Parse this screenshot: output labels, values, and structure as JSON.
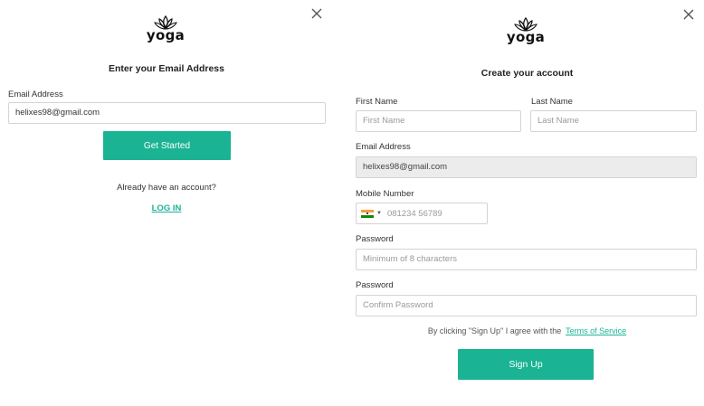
{
  "email_step": {
    "logo_text": "yoga",
    "heading": "Enter your Email Address",
    "email_label": "Email Address",
    "email_value": "helixes98@gmail.com",
    "submit_label": "Get Started",
    "have_account_text": "Already have an account?",
    "login_link": "LOG IN",
    "close_icon": "close-icon"
  },
  "signup": {
    "logo_text": "yoga",
    "heading": "Create your account",
    "first_name_label": "First Name",
    "first_name_placeholder": "First Name",
    "last_name_label": "Last Name",
    "last_name_placeholder": "Last Name",
    "email_label": "Email Address",
    "email_value": "helixes98@gmail.com",
    "mobile_label": "Mobile Number",
    "mobile_placeholder": "081234 56789",
    "country_flag_icon": "india-flag-icon",
    "password_label": "Password",
    "password_placeholder": "Minimum of 8 characters",
    "confirm_label": "Password",
    "confirm_placeholder": "Confirm Password",
    "terms_prefix": "By clicking \"Sign Up\" I agree with the",
    "terms_link": "Terms of Service",
    "submit_label": "Sign Up",
    "close_icon": "close-icon"
  },
  "colors": {
    "accent": "#1ab394",
    "readonly_bg": "#ececec",
    "border": "#d4d4d4"
  }
}
